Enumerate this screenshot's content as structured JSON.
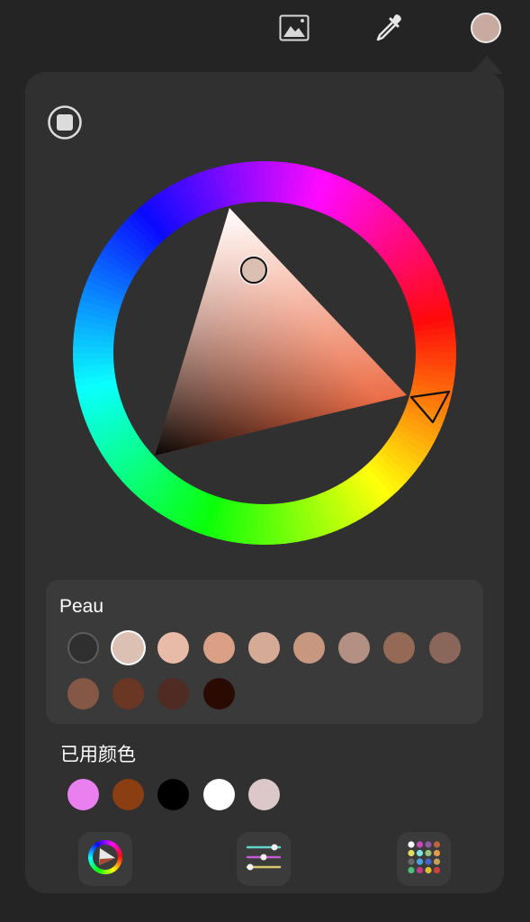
{
  "toolbar": {
    "gallery_icon": "image-icon",
    "eyedropper_icon": "eyedropper-icon",
    "current_color": "#c9aaa0"
  },
  "picker": {
    "mode": "disc",
    "hue_marker_hue_deg": 14,
    "selected_color": "#dcbfb3"
  },
  "palette": {
    "title": "Peau",
    "swatches": [
      "",
      "#dcc0b4",
      "#e7bba8",
      "#d9a085",
      "#d6ab96",
      "#c7977f",
      "#b39083",
      "#946956",
      "#8b675b",
      "#845747",
      "#6a3724",
      "#4f2b24",
      "#2a0b04"
    ]
  },
  "recent": {
    "title": "已用颜色",
    "colors": [
      "#ea80f0",
      "#8a3e12",
      "#000000",
      "#ffffff",
      "#dcc7c9"
    ]
  },
  "bottom_bar": {
    "disc_icon": "color-disc-icon",
    "sliders_icon": "sliders-icon",
    "palettes_icon": "palettes-icon"
  }
}
